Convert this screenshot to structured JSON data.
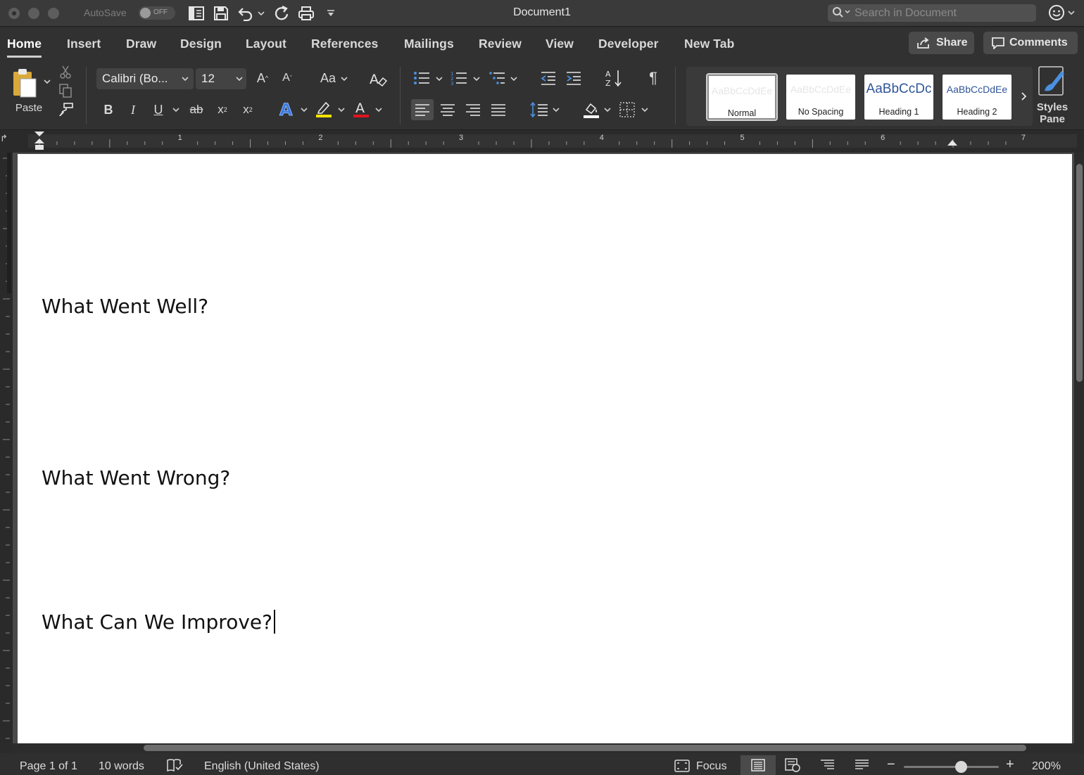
{
  "window": {
    "title": "Document1",
    "autosave_label": "AutoSave",
    "autosave_state": "OFF",
    "search_placeholder": "Search in Document"
  },
  "tabs": [
    "Home",
    "Insert",
    "Draw",
    "Design",
    "Layout",
    "References",
    "Mailings",
    "Review",
    "View",
    "Developer",
    "New Tab"
  ],
  "actions": {
    "share": "Share",
    "comments": "Comments"
  },
  "ribbon": {
    "paste_label": "Paste",
    "font_name": "Calibri (Bo...",
    "font_size": "12",
    "change_case_label": "Aa",
    "highlight_color": "#f2e200",
    "font_color": "#e0141e",
    "styles": [
      {
        "sample": "AaBbCcDdEe",
        "name": "Normal",
        "color": "#222222"
      },
      {
        "sample": "AaBbCcDdEe",
        "name": "No Spacing",
        "color": "#222222"
      },
      {
        "sample": "AaBbCcDc",
        "name": "Heading 1",
        "color": "#2f5597"
      },
      {
        "sample": "AaBbCcDdEe",
        "name": "Heading 2",
        "color": "#2f5597"
      }
    ],
    "styles_pane_label": "Styles\nPane"
  },
  "ruler": {
    "marks": [
      "1",
      "2",
      "3",
      "4",
      "5",
      "6",
      "7"
    ]
  },
  "document": {
    "paragraphs": [
      "What Went Well?",
      "What Went Wrong?",
      "What Can We Improve?"
    ]
  },
  "status": {
    "page": "Page 1 of 1",
    "words": "10 words",
    "language": "English (United States)",
    "focus": "Focus",
    "zoom": "200%",
    "zoom_minus": "−",
    "zoom_plus": "+"
  }
}
